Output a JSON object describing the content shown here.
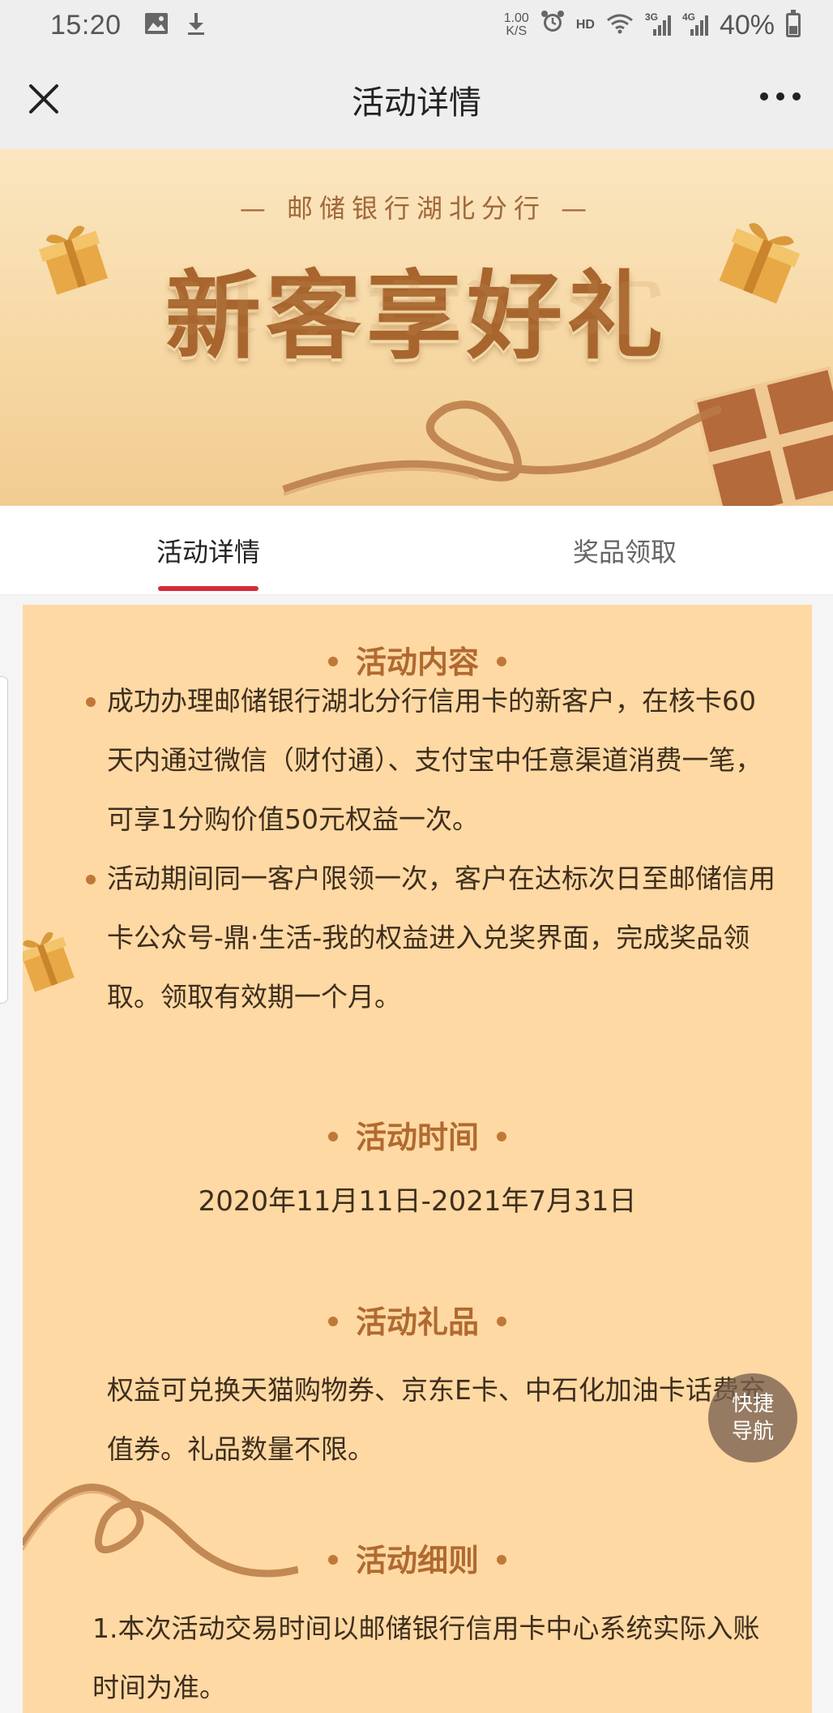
{
  "status_bar": {
    "time": "15:20",
    "net_speed_value": "1.00",
    "net_speed_unit": "K/S",
    "hd": "HD",
    "signal_3g": "3G",
    "signal_4g": "4G",
    "battery_percent": "40%",
    "battery_level": 0.4
  },
  "nav": {
    "title": "活动详情"
  },
  "banner": {
    "subtitle": "— 邮储银行湖北分行 —",
    "title": "新客享好礼"
  },
  "tabs": [
    {
      "label": "活动详情",
      "active": true
    },
    {
      "label": "奖品领取",
      "active": false
    }
  ],
  "sections": {
    "content": {
      "title": "活动内容",
      "items": [
        "成功办理邮储银行湖北分行信用卡的新客户，在核卡60天内通过微信（财付通）、支付宝中任意渠道消费一笔，可享1分购价值50元权益一次。",
        "活动期间同一客户限领一次，客户在达标次日至邮储信用卡公众号-鼎·生活-我的权益进入兑奖界面，完成奖品领取。领取有效期一个月。"
      ]
    },
    "time": {
      "title": "活动时间",
      "value": "2020年11月11日-2021年7月31日"
    },
    "gift": {
      "title": "活动礼品",
      "text": "权益可兑换天猫购物券、京东E卡、中石化加油卡话费充值券。礼品数量不限。"
    },
    "rules": {
      "title": "活动细则",
      "text": "1.本次活动交易时间以邮储银行信用卡中心系统实际入账时间为准。"
    }
  },
  "quick_nav": {
    "line1": "快捷",
    "line2": "导航"
  },
  "colors": {
    "accent": "#d62b3a",
    "card_bg": "#ffd9a3",
    "section_title": "#b06a30"
  }
}
